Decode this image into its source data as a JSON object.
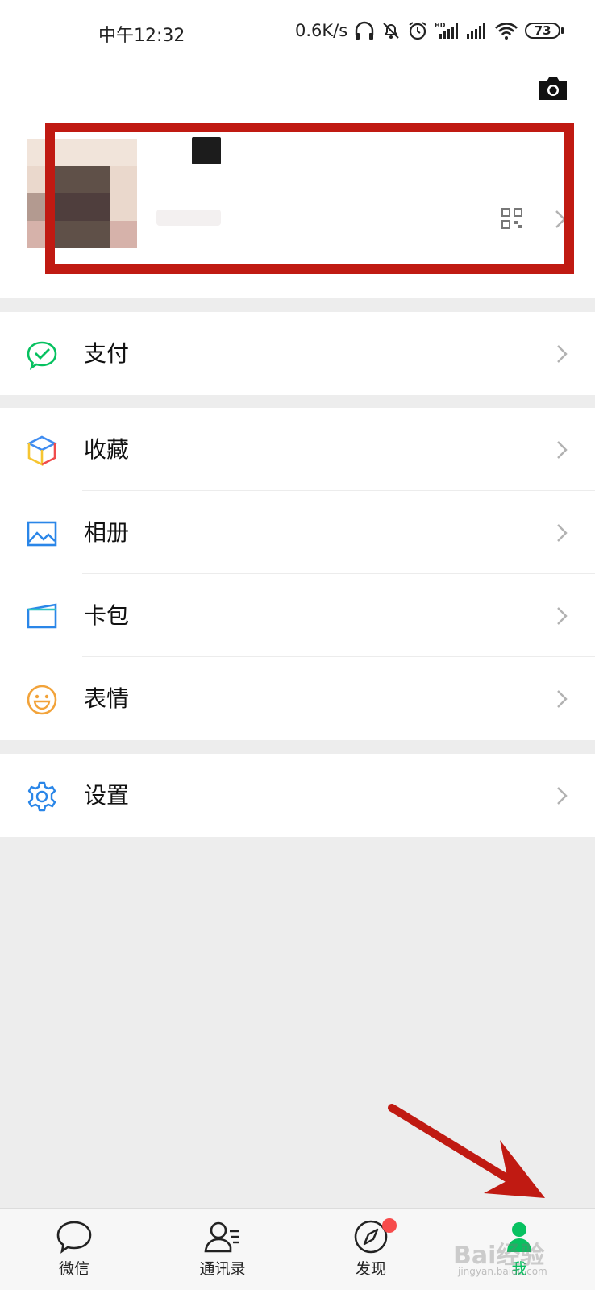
{
  "status_bar": {
    "time": "中午12:32",
    "net_speed": "0.6K/s",
    "battery": "73"
  },
  "profile": {
    "camera_icon": "camera-icon",
    "qr_icon": "qr-code-icon"
  },
  "menu": {
    "pay": {
      "label": "支付",
      "icon": "wechat-pay-icon"
    },
    "favorites": {
      "label": "收藏",
      "icon": "favorites-cube-icon"
    },
    "album": {
      "label": "相册",
      "icon": "album-icon"
    },
    "cards": {
      "label": "卡包",
      "icon": "card-wallet-icon"
    },
    "stickers": {
      "label": "表情",
      "icon": "smile-icon"
    },
    "settings": {
      "label": "设置",
      "icon": "gear-icon"
    }
  },
  "tabbar": {
    "tabs": [
      {
        "label": "微信",
        "icon": "chat-bubble-icon"
      },
      {
        "label": "通讯录",
        "icon": "contacts-icon"
      },
      {
        "label": "发现",
        "icon": "compass-icon"
      },
      {
        "label": "我",
        "icon": "me-icon"
      }
    ],
    "active": "我"
  },
  "watermark": {
    "text": "Bai经验",
    "sub": "jingyan.baidu.com"
  },
  "colors": {
    "accent_green": "#07c160",
    "annotation_red": "#c01a12",
    "badge_red": "#f74c4c",
    "background": "#ededed"
  }
}
